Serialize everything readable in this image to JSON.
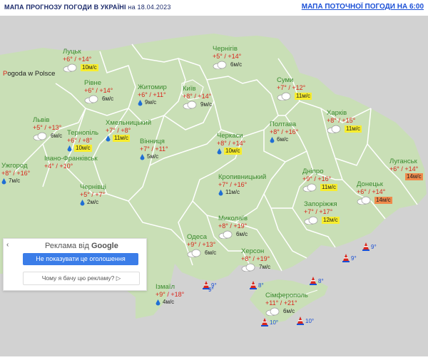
{
  "header": {
    "title": "МАПА ПРОГНОЗУ ПОГОДИ В УКРАЇНІ",
    "date": "на 18.04.2023",
    "current_map_link": "МАПА ПОТОЧНОЇ ПОГОДИ НА 6:00"
  },
  "neighbor_link": {
    "prefix": "P",
    "text": "ogoda w Polsce"
  },
  "colors": {
    "land": "#c9dfb6",
    "border": "#ffffff",
    "sea": "#d2d2d2",
    "city_name": "#3a8a2e",
    "temp": "#d9261c",
    "wind_yellow": "#f7ed2e",
    "wind_orange": "#f08a4b"
  },
  "cities": {
    "lutsk": {
      "name": "Луцьк",
      "temps": "+6° / +14°",
      "wind": "10м/с",
      "icon": "cloud-icon"
    },
    "rivne": {
      "name": "Рівне",
      "temps": "+6° / +14°",
      "wind": "6м/с",
      "icon": "cloud-icon"
    },
    "zhytomyr": {
      "name": "Житомир",
      "temps": "+6° / +11°",
      "wind": "9м/с",
      "icon": "rain-icon"
    },
    "kyiv": {
      "name": "Київ",
      "temps": "+8° / +14°",
      "wind": "9м/с",
      "icon": "cloud-icon"
    },
    "chernihiv": {
      "name": "Чернігів",
      "temps": "+5° / +14°",
      "wind": "6м/с",
      "icon": "cloud-icon"
    },
    "sumy": {
      "name": "Суми",
      "temps": "+7° / +12°",
      "wind": "11м/с",
      "icon": "cloud-icon"
    },
    "kharkiv": {
      "name": "Харків",
      "temps": "+8° / +15°",
      "wind": "11м/с",
      "icon": "cloud-icon"
    },
    "poltava": {
      "name": "Полтава",
      "temps": "+8° / +16°",
      "wind": "6м/с",
      "icon": "rain-icon"
    },
    "lviv": {
      "name": "Львів",
      "temps": "+5° / +13°",
      "wind": "6м/с",
      "icon": "cloud-icon"
    },
    "ternopil": {
      "name": "Тернопіль",
      "temps": "+6° / +8°",
      "wind": "10м/с",
      "icon": "rain-icon"
    },
    "khmelnytskyi": {
      "name": "Хмельницький",
      "temps": "+7° / +8°",
      "wind": "11м/с",
      "icon": "rain-icon"
    },
    "vinnytsia": {
      "name": "Вінниця",
      "temps": "+7° / +11°",
      "wind": "5м/с",
      "icon": "rain-icon"
    },
    "cherkasy": {
      "name": "Черкаси",
      "temps": "+8° / +14°",
      "wind": "10м/с",
      "icon": "rain-icon"
    },
    "uzhhorod": {
      "name": "Ужгород",
      "temps": "+8° / +16°",
      "wind": "7м/с",
      "icon": "rain-icon"
    },
    "ivano_frankivsk": {
      "name": "Івано-Франківськ",
      "temps": "+4° / +10°",
      "wind": "",
      "icon": ""
    },
    "chernivtsi": {
      "name": "Чернівці",
      "temps": "+5° / +7°",
      "wind": "2м/с",
      "icon": "rain-icon"
    },
    "kropyvnytskyi": {
      "name": "Кропивницький",
      "temps": "+7° / +16°",
      "wind": "11м/с",
      "icon": "rain-icon"
    },
    "dnipro": {
      "name": "Дніпро",
      "temps": "+9° / +16°",
      "wind": "11м/с",
      "icon": "cloud-icon"
    },
    "luhansk": {
      "name": "Луганськ",
      "temps": "+6° / +14°",
      "wind": "14м/с",
      "icon": "cloud-icon"
    },
    "donetsk": {
      "name": "Донецьк",
      "temps": "+6° / +14°",
      "wind": "14м/с",
      "icon": "cloud-icon"
    },
    "zaporizhzhia": {
      "name": "Запоріжжя",
      "temps": "+7° / +17°",
      "wind": "12м/с",
      "icon": "cloud-icon"
    },
    "mykolaiv": {
      "name": "Миколаїв",
      "temps": "+8° / +19°",
      "wind": "6м/с",
      "icon": "cloud-icon"
    },
    "odesa": {
      "name": "Одеса",
      "temps": "+9° / +13°",
      "wind": "6м/с",
      "icon": "cloud-icon"
    },
    "kherson": {
      "name": "Херсон",
      "temps": "+8° / +19°",
      "wind": "7м/с",
      "icon": "cloud-icon"
    },
    "izmail": {
      "name": "Ізмаїл",
      "temps": "+9° / +18°",
      "wind": "4м/с",
      "icon": "rain-icon"
    },
    "simferopol": {
      "name": "Сімферополь",
      "temps": "+11° / +21°",
      "wind": "6м/с",
      "icon": "cloud-icon"
    }
  },
  "sea_temps": [
    "9°",
    "9°",
    "9°",
    "9°",
    "8°",
    "8°",
    "10°",
    "10°"
  ],
  "ad": {
    "title_prefix": "Реклама від ",
    "title_brand": "Google",
    "back_icon": "‹",
    "hide_button": "Не показувати це оголошення",
    "why_button": "Чому я бачу цю рекламу?",
    "why_icon": "▷"
  }
}
